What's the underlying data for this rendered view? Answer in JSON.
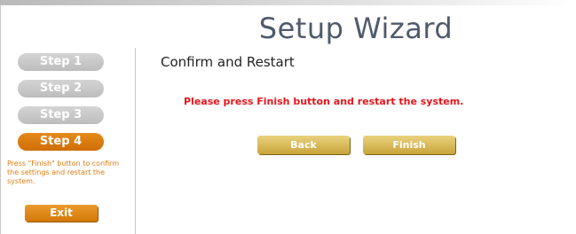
{
  "header": {
    "title": "Setup Wizard"
  },
  "sidebar": {
    "steps": [
      {
        "label": "Step 1",
        "state": "inactive"
      },
      {
        "label": "Step 2",
        "state": "inactive"
      },
      {
        "label": "Step 3",
        "state": "inactive"
      },
      {
        "label": "Step 4",
        "state": "active"
      }
    ],
    "help_text": "Press \"Finish\" button to confirm the settings and restart the system.",
    "exit_label": "Exit"
  },
  "main": {
    "heading": "Confirm and Restart",
    "message": "Please press Finish button and restart the system.",
    "back_label": "Back",
    "finish_label": "Finish"
  },
  "colors": {
    "active_step": "#d97a0d",
    "inactive_step": "#c6c6c6",
    "message_red": "#e8141c",
    "button_gold": "#d8b955",
    "title_text": "#4f5a6b"
  }
}
